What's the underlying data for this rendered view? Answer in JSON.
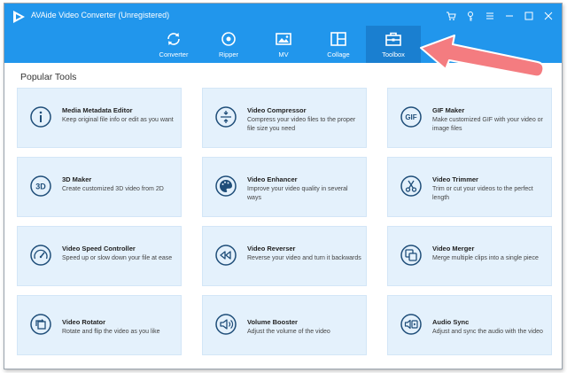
{
  "app": {
    "title": "AVAide Video Converter (Unregistered)",
    "accent_color": "#2196ec",
    "window_controls": [
      "cart-icon",
      "key-icon",
      "menu-icon",
      "minimize-icon",
      "maximize-icon",
      "close-icon"
    ]
  },
  "nav": {
    "tabs": [
      {
        "label": "Converter",
        "icon": "convert-icon"
      },
      {
        "label": "Ripper",
        "icon": "disc-icon"
      },
      {
        "label": "MV",
        "icon": "mv-icon"
      },
      {
        "label": "Collage",
        "icon": "collage-icon"
      },
      {
        "label": "Toolbox",
        "icon": "toolbox-icon",
        "active": true
      }
    ]
  },
  "section_title": "Popular Tools",
  "tools": [
    {
      "name": "Media Metadata Editor",
      "desc": "Keep original file info or edit as you want",
      "icon": "info-icon"
    },
    {
      "name": "Video Compressor",
      "desc": "Compress your video files to the proper file size you need",
      "icon": "compress-icon"
    },
    {
      "name": "GIF Maker",
      "desc": "Make customized GIF with your video or image files",
      "icon": "gif-icon"
    },
    {
      "name": "3D Maker",
      "desc": "Create customized 3D video from 2D",
      "icon": "3d-icon"
    },
    {
      "name": "Video Enhancer",
      "desc": "Improve your video quality in several ways",
      "icon": "palette-icon"
    },
    {
      "name": "Video Trimmer",
      "desc": "Trim or cut your videos to the perfect length",
      "icon": "scissors-icon"
    },
    {
      "name": "Video Speed Controller",
      "desc": "Speed up or slow down your file at ease",
      "icon": "speedometer-icon"
    },
    {
      "name": "Video Reverser",
      "desc": "Reverse your video and turn it backwards",
      "icon": "rewind-icon"
    },
    {
      "name": "Video Merger",
      "desc": "Merge multiple clips into a single piece",
      "icon": "merge-icon"
    },
    {
      "name": "Video Rotator",
      "desc": "Rotate and flip the video as you like",
      "icon": "rotate-icon"
    },
    {
      "name": "Volume Booster",
      "desc": "Adjust the volume of the video",
      "icon": "volume-icon"
    },
    {
      "name": "Audio Sync",
      "desc": "Adjust and sync the audio with the video",
      "icon": "audio-sync-icon"
    }
  ]
}
